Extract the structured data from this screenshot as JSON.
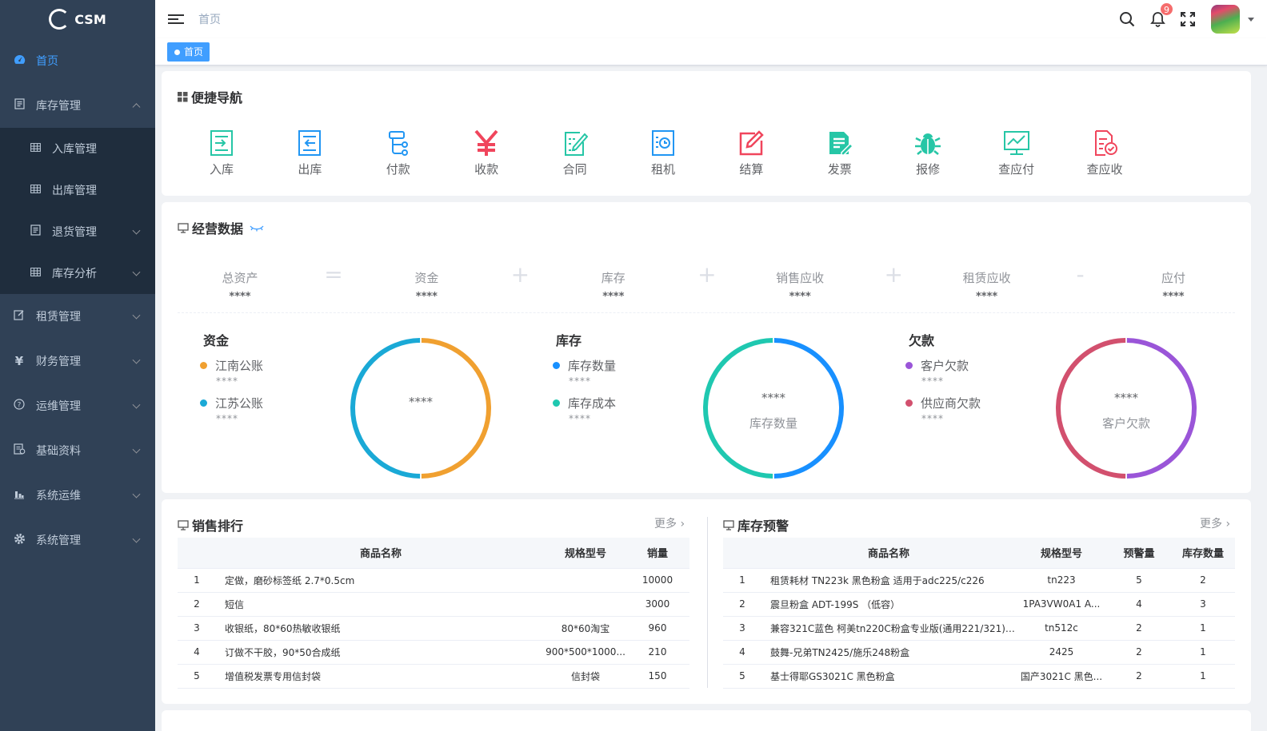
{
  "sidebar": {
    "brand": "CSM",
    "items": [
      {
        "label": "首页",
        "icon": "dashboard-icon",
        "active": true
      },
      {
        "label": "库存管理",
        "icon": "document-icon",
        "expanded": true,
        "children": [
          {
            "label": "入库管理",
            "icon": "table-icon"
          },
          {
            "label": "出库管理",
            "icon": "table-icon"
          },
          {
            "label": "退货管理",
            "icon": "document-icon"
          },
          {
            "label": "库存分析",
            "icon": "table-icon"
          }
        ]
      },
      {
        "label": "租赁管理",
        "icon": "edit-icon"
      },
      {
        "label": "财务管理",
        "icon": "yen-icon"
      },
      {
        "label": "运维管理",
        "icon": "question-icon"
      },
      {
        "label": "基础资料",
        "icon": "form-icon"
      },
      {
        "label": "系统运维",
        "icon": "chart-icon"
      },
      {
        "label": "系统管理",
        "icon": "gear-icon"
      }
    ]
  },
  "header": {
    "breadcrumb": "首页",
    "notification_count": "9"
  },
  "tags": [
    {
      "label": "首页",
      "active": true
    }
  ],
  "quick_nav": {
    "title": "便捷导航",
    "items": [
      {
        "label": "入库",
        "icon": "inbound-icon",
        "color": "#26c6a6"
      },
      {
        "label": "出库",
        "icon": "outbound-icon",
        "color": "#2196f3"
      },
      {
        "label": "付款",
        "icon": "payment-icon",
        "color": "#2196f3"
      },
      {
        "label": "收款",
        "icon": "yen-icon",
        "color": "#f0455c"
      },
      {
        "label": "合同",
        "icon": "contract-icon",
        "color": "#26c6a6"
      },
      {
        "label": "租机",
        "icon": "rental-icon",
        "color": "#2196f3"
      },
      {
        "label": "结算",
        "icon": "settle-icon",
        "color": "#f0455c"
      },
      {
        "label": "发票",
        "icon": "invoice-icon",
        "color": "#26c6a6"
      },
      {
        "label": "报修",
        "icon": "bug-icon",
        "color": "#26c6a6"
      },
      {
        "label": "查应付",
        "icon": "monitor-icon",
        "color": "#26c6a6"
      },
      {
        "label": "查应收",
        "icon": "receivable-icon",
        "color": "#f0455c"
      }
    ]
  },
  "business": {
    "title": "经营数据",
    "equation": [
      {
        "label": "总资产",
        "value": "****"
      },
      {
        "label": "资金",
        "value": "****"
      },
      {
        "label": "库存",
        "value": "****"
      },
      {
        "label": "销售应收",
        "value": "****"
      },
      {
        "label": "租赁应收",
        "value": "****"
      },
      {
        "label": "应付",
        "value": "****"
      }
    ],
    "operators": [
      "=",
      "+",
      "+",
      "+",
      "-"
    ],
    "groups": [
      {
        "title": "资金",
        "center_value": "****",
        "center_label": "",
        "legend": [
          {
            "label": "江南公账",
            "value": "****",
            "color": "#f0a030"
          },
          {
            "label": "江苏公账",
            "value": "****",
            "color": "#1aa9d6"
          }
        ]
      },
      {
        "title": "库存",
        "center_value": "****",
        "center_label": "库存数量",
        "legend": [
          {
            "label": "库存数量",
            "value": "****",
            "color": "#1890ff"
          },
          {
            "label": "库存成本",
            "value": "****",
            "color": "#1fc8b0"
          }
        ]
      },
      {
        "title": "欠款",
        "center_value": "****",
        "center_label": "客户欠款",
        "legend": [
          {
            "label": "客户欠款",
            "value": "****",
            "color": "#9a55d8"
          },
          {
            "label": "供应商欠款",
            "value": "****",
            "color": "#d2506e"
          }
        ]
      }
    ]
  },
  "sales_rank": {
    "title": "销售排行",
    "more": "更多",
    "columns": [
      "",
      "商品名称",
      "规格型号",
      "销量"
    ],
    "rows": [
      [
        "1",
        "定做，磨砂标签纸 2.7*0.5cm",
        "",
        "10000"
      ],
      [
        "2",
        "短信",
        "",
        "3000"
      ],
      [
        "3",
        "收银纸，80*60热敏收银纸",
        "80*60淘宝",
        "960"
      ],
      [
        "4",
        "订做不干胶，90*50合成纸",
        "900*500*1000...",
        "210"
      ],
      [
        "5",
        "增值税发票专用信封袋",
        "信封袋",
        "150"
      ]
    ]
  },
  "stock_alert": {
    "title": "库存预警",
    "more": "更多",
    "columns": [
      "",
      "商品名称",
      "规格型号",
      "预警量",
      "库存数量"
    ],
    "rows": [
      [
        "1",
        "租赁耗材 TN223k 黑色粉盒 适用于adc225/c226",
        "tn223",
        "5",
        "2"
      ],
      [
        "2",
        "震旦粉盒 ADT-199S （低容）",
        "1PA3VW0A1 A...",
        "4",
        "3"
      ],
      [
        "3",
        "兼容321C蓝色 柯美tn220C粉盒专业版(通用221/321) ...",
        "tn512c",
        "2",
        "1"
      ],
      [
        "4",
        "鼓舞-兄弟TN2425/施乐248粉盒",
        "2425",
        "2",
        "1"
      ],
      [
        "5",
        "基士得耶GS3021C 黑色粉盒",
        "国产3021C 黑色...",
        "2",
        "1"
      ]
    ]
  }
}
